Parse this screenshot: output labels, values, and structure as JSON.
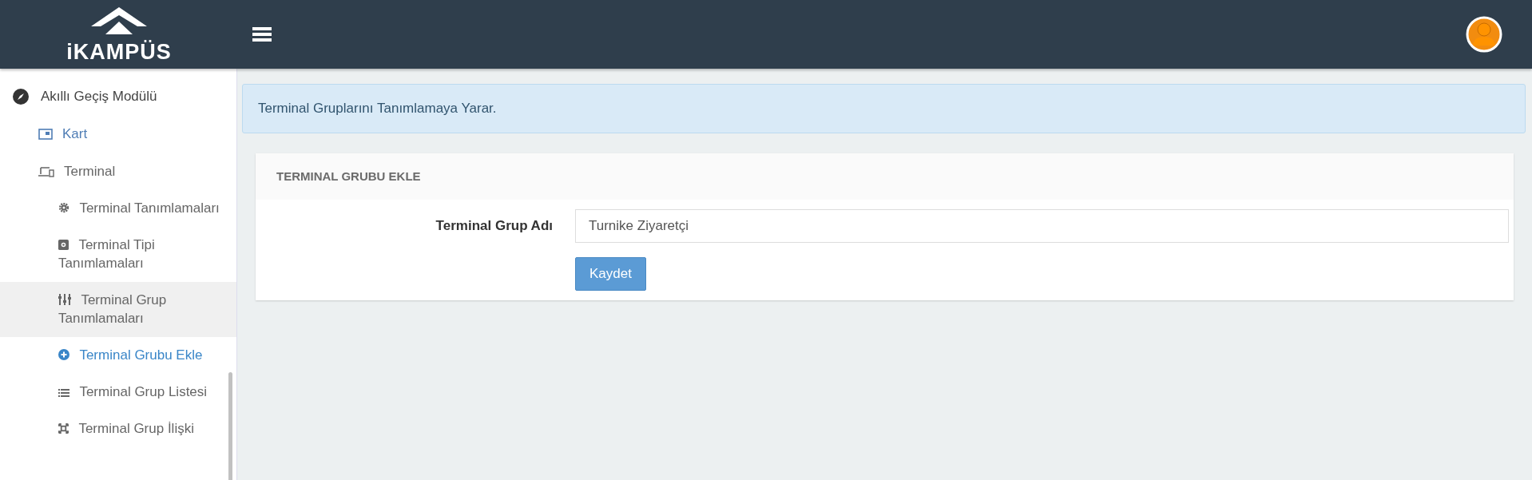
{
  "header": {
    "logo_text": "iKAMPÜS"
  },
  "sidebar": {
    "items": [
      {
        "label": "Akıllı Geçiş Modülü",
        "kind": "compass",
        "selected": false,
        "highlighted": false,
        "children": [
          {
            "label": "Kart",
            "kind": "card",
            "selected": true,
            "highlighted": false
          },
          {
            "label": "Terminal",
            "kind": "device",
            "selected": false,
            "highlighted": false,
            "children": [
              {
                "label": "Terminal Tanımlamaları",
                "kind": "gear",
                "selected": false,
                "highlighted": false
              },
              {
                "label": "Terminal Tipi Tanımlamaları",
                "kind": "square",
                "selected": false,
                "highlighted": false
              },
              {
                "label": "Terminal Grup Tanımlamaları",
                "kind": "sliders",
                "selected": false,
                "highlighted": true
              },
              {
                "label": "Terminal Grubu Ekle",
                "kind": "plus",
                "selected": true,
                "highlighted": false
              },
              {
                "label": "Terminal Grup Listesi",
                "kind": "list",
                "selected": false,
                "highlighted": false
              },
              {
                "label": "Terminal Grup İlişki",
                "kind": "link",
                "selected": false,
                "highlighted": false
              }
            ]
          }
        ]
      }
    ]
  },
  "alert": {
    "text": "Terminal Gruplarını Tanımlamaya Yarar."
  },
  "form": {
    "title": "TERMINAL GRUBU EKLE",
    "field_label": "Terminal Grup Adı",
    "field_value": "Turnike Ziyaretçi",
    "button": "Kaydet"
  }
}
